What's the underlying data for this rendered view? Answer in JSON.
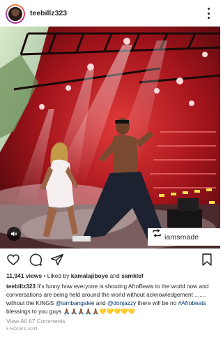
{
  "post": {
    "username": "teebillz323",
    "repost_credit": "iamsmade",
    "views": "11,941 views",
    "liked_by_prefix": " • Liked by ",
    "liked_by_1": "kamalajiboye",
    "liked_by_and": " and ",
    "liked_by_2": "samklef",
    "caption_user": "teebillz323",
    "caption_part1": " It's funny how everyone is shouting AfroBeats to the world now and conversations are being held around the world without acknowledgement ....... without the KINGS ",
    "mention_1": "@iambangalee",
    "caption_and": " and ",
    "mention_2": "@donjazzy",
    "caption_part2": " there will be no ",
    "hashtag": "#Afrobeats",
    "caption_part3": " blessings to you guys ",
    "emoji": "🙏🏾🙏🏾🙏🏾🙏🏾🙏🏾💛💛💛💛💛",
    "view_comments": "View All 67 Comments",
    "time_ago": "5 HOURS AGO"
  },
  "icons": {
    "more": "more-vertical-icon",
    "mute": "speaker-mute-icon",
    "repost": "repost-icon",
    "like": "heart-icon",
    "comment": "comment-icon",
    "share": "send-icon",
    "save": "bookmark-icon"
  },
  "colors": {
    "text": "#262626",
    "muted": "#8e8e8e",
    "link": "#003569",
    "stage_red": "#c81e24"
  }
}
